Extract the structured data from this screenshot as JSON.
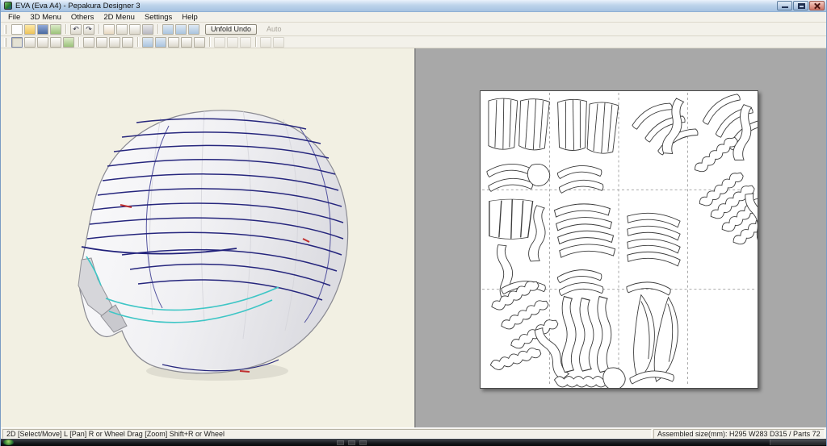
{
  "window": {
    "title": "EVA (Eva A4) - Pepakura Designer 3"
  },
  "menu": {
    "items": [
      "File",
      "3D Menu",
      "Others",
      "2D Menu",
      "Settings",
      "Help"
    ]
  },
  "toolbar": {
    "unfold_undo_label": "Unfold Undo",
    "auto_label": "Auto",
    "glyphs": {
      "undo": "↶",
      "redo": "↷"
    },
    "row1_icons": [
      "new-file-icon",
      "open-folder-icon",
      "save-icon",
      "texture-icon",
      "undo-icon",
      "redo-icon",
      "pen-icon",
      "eraser-icon",
      "measure-icon",
      "print-icon",
      "view-split-icon",
      "view-3d-icon",
      "view-2d-icon"
    ],
    "row2_icons": [
      "select-move-icon",
      "rotate-icon",
      "pan-icon",
      "zoom-icon",
      "edit-edge-icon",
      "divide-icon",
      "join-icon",
      "flip-icon",
      "flap-icon",
      "order-icon",
      "part-number-icon",
      "grid-icon",
      "check-icon",
      "scale-icon"
    ],
    "row2_right_icons": [
      "align-left-icon",
      "align-center-icon",
      "align-right-icon",
      "zoom-in-icon",
      "zoom-out-icon"
    ]
  },
  "statusbar": {
    "left": "2D [Select/Move] L [Pan] R or Wheel Drag [Zoom] Shift+R or Wheel",
    "right": "Assembled size(mm): H295 W283 D315 / Parts 72"
  },
  "colors": {
    "titlebar": "#bed4eb",
    "pane3d_bg": "#f2f0e3",
    "pane2d_bg": "#a8a8a8",
    "sheet": "#ffffff",
    "fold_line_dark": "#26267d",
    "fold_line_cyan": "#3fc6c6",
    "accent_red": "#c03030"
  }
}
